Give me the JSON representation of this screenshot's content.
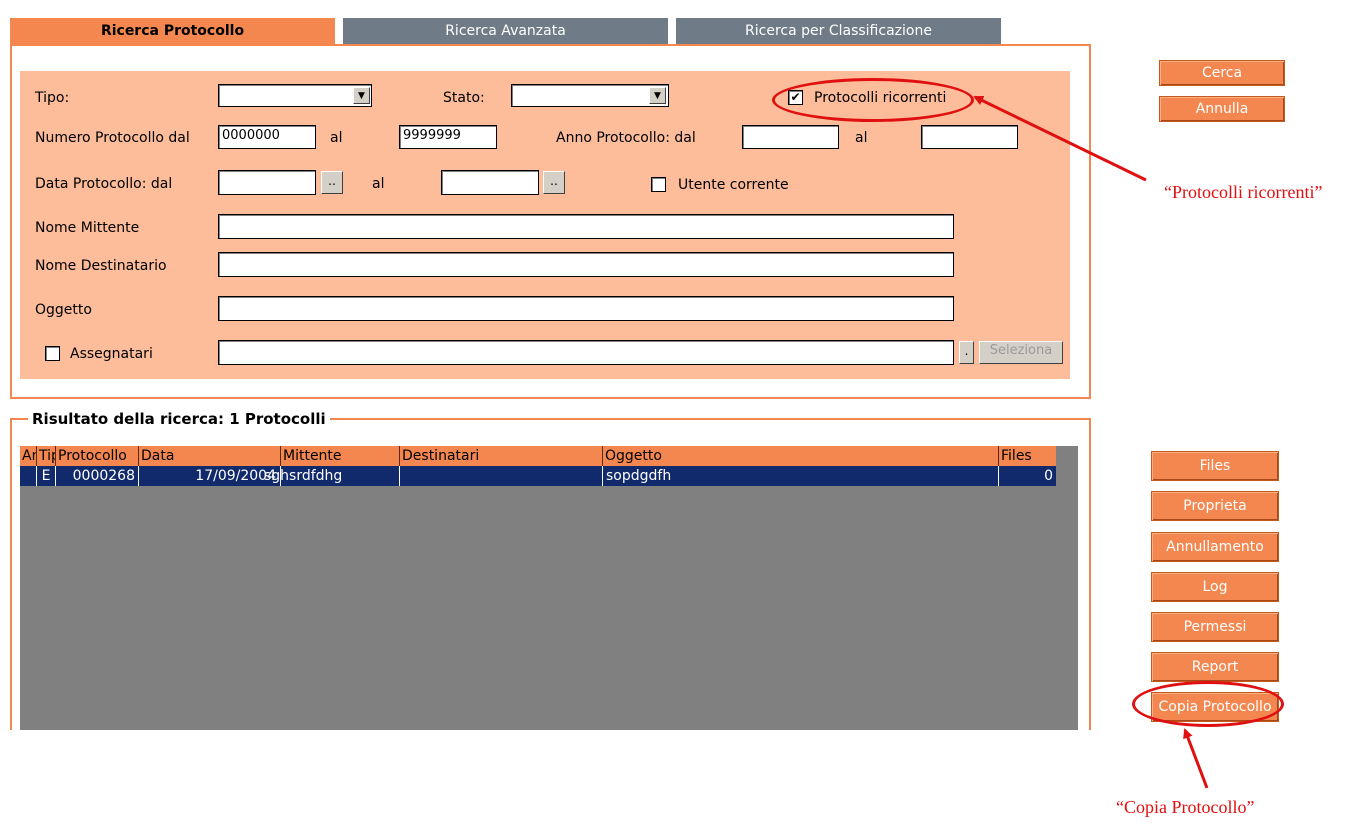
{
  "tabs": [
    "Ricerca Protocollo",
    "Ricerca Avanzata",
    "Ricerca per Classificazione"
  ],
  "form": {
    "tipo_label": "Tipo:",
    "tipo_value": "",
    "stato_label": "Stato:",
    "stato_value": "",
    "ricorrenti_label": "Protocolli ricorrenti",
    "ricorrenti_checked": "✔",
    "numero_label": "Numero Protocollo dal",
    "numero_dal": "0000000",
    "numero_al_label": "al",
    "numero_al": "9999999",
    "anno_label": "Anno Protocollo: dal",
    "anno_dal": "",
    "anno_al_label": "al",
    "anno_al": "",
    "data_label": "Data Protocollo: dal",
    "data_dal": "",
    "data_al_label": "al",
    "data_al": "",
    "dots": "..",
    "utente_label": "Utente corrente",
    "mittente_label": "Nome Mittente",
    "mittente_value": "",
    "destinatario_label": "Nome Destinatario",
    "destinatario_value": "",
    "oggetto_label": "Oggetto",
    "oggetto_value": "",
    "assegnatari_label": "Assegnatari",
    "assegnatari_value": "",
    "small_dots": ".",
    "seleziona_label": "Seleziona"
  },
  "top_buttons": {
    "cerca": "Cerca",
    "annulla": "Annulla"
  },
  "results": {
    "title": "Risultato della ricerca: 1 Protocolli",
    "columns": [
      "An",
      "Tip",
      "Protocollo",
      "Data",
      "Mittente",
      "Destinatari",
      "Oggetto",
      "Files"
    ],
    "rows": [
      {
        "an": "",
        "tip": "E",
        "protocollo": "0000268",
        "data": "17/09/2004",
        "mittente": "sghsrdfdhg",
        "destinatari": "",
        "oggetto": "sopdgdfh",
        "files": "0"
      }
    ]
  },
  "side_buttons": [
    "Files",
    "Proprieta",
    "Annullamento",
    "Log",
    "Permessi",
    "Report",
    "Copia Protocollo"
  ],
  "annotations": {
    "ricorrenti": "“Protocolli ricorrenti”",
    "copia": "“Copia Protocollo”"
  },
  "colors": {
    "accent": "#f3874f",
    "panel": "#fdbd9b",
    "tab_inactive": "#6f7c88",
    "selection": "#102a6b",
    "annotation": "#e01010"
  }
}
